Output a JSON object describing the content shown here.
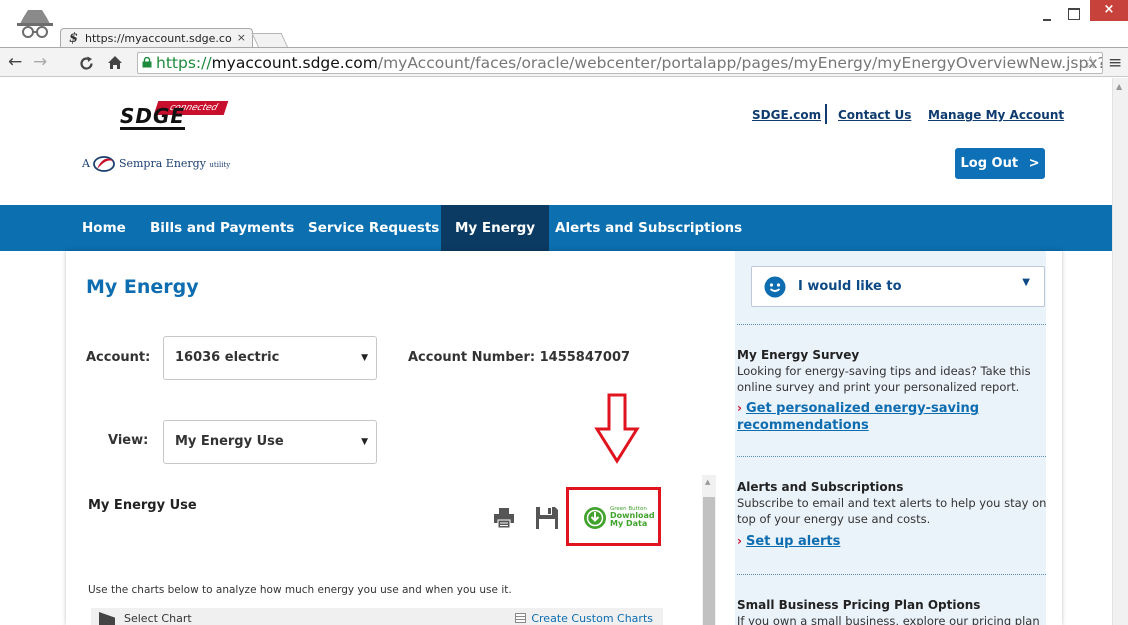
{
  "browser": {
    "tab_title": "https://myaccount.sdge.co",
    "tab_close": "×",
    "url_scheme": "https://",
    "url_host": "myaccount.sdge.com",
    "url_path": "/myAccount/faces/oracle/webcenter/portalapp/pages/myEnergy/myEnergyOverviewNew.jspx?_adf.ctrl-sta",
    "window_close": "×"
  },
  "header": {
    "logo_text": "SDGE",
    "logo_badge": "connected",
    "sempra_prefix": "A",
    "sempra_text": "Sempra Energy",
    "sempra_suffix": "utility",
    "links": [
      "SDGE.com",
      "Contact Us",
      "Manage My Account"
    ],
    "logout_label": "Log Out",
    "logout_chevron": ">"
  },
  "nav": {
    "items": [
      "Home",
      "Bills and Payments",
      "Service Requests",
      "My Energy",
      "Alerts and Subscriptions"
    ],
    "active": "My Energy"
  },
  "main": {
    "title": "My Energy",
    "account_label": "Account:",
    "account_value": "16036 electric",
    "account_number_label": "Account Number:",
    "account_number": "1455847007",
    "view_label": "View:",
    "view_value": "My Energy Use",
    "panel_title": "My Energy Use",
    "green_button_line1": "Green Button",
    "green_button_line2": "Download",
    "green_button_line3": "My Data",
    "chart_info": "Use the charts below to analyze how much energy you use and when you use it.",
    "select_chart_label": "Select Chart",
    "custom_charts_label": "Create Custom Charts"
  },
  "sidebar": {
    "dropdown_label": "I would like to",
    "survey_title": "My Energy Survey",
    "survey_text": "Looking for energy-saving tips and ideas? Take this online survey and print your personalized report.",
    "survey_link": "Get personalized energy-saving recommendations",
    "alerts_title": "Alerts and Subscriptions",
    "alerts_text": "Subscribe to email and text alerts to help you stay on top of your energy use and costs.",
    "alerts_link": "Set up alerts",
    "pricing_title": "Small Business Pricing Plan Options",
    "pricing_text": "If you own a small business, explore our pricing plan"
  },
  "colors": {
    "nav_blue": "#0b6fb0",
    "nav_active": "#0b3b63",
    "title_blue": "#0e6db0",
    "highlight_red": "#e0141e",
    "green_button": "#41a22d"
  }
}
